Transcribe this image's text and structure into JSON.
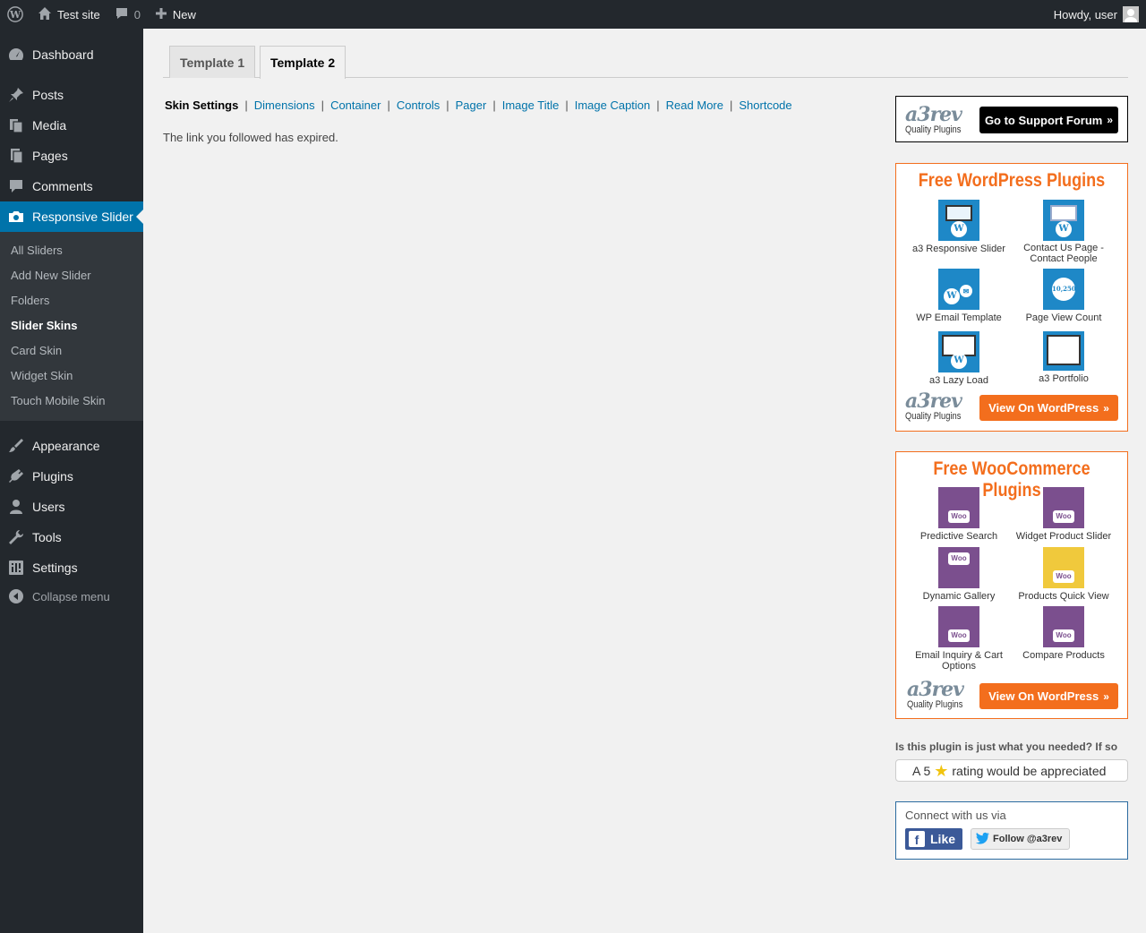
{
  "adminbar": {
    "site_name": "Test site",
    "comments_count": "0",
    "new_label": "New",
    "greeting": "Howdy, user"
  },
  "sidebar": {
    "items": [
      {
        "label": "Dashboard",
        "icon": "dashboard-icon"
      },
      {
        "label": "Posts",
        "icon": "pin-icon"
      },
      {
        "label": "Media",
        "icon": "media-icon"
      },
      {
        "label": "Pages",
        "icon": "pages-icon"
      },
      {
        "label": "Comments",
        "icon": "comment-icon"
      },
      {
        "label": "Responsive Slider",
        "icon": "camera-icon"
      },
      {
        "label": "Appearance",
        "icon": "brush-icon"
      },
      {
        "label": "Plugins",
        "icon": "plug-icon"
      },
      {
        "label": "Users",
        "icon": "user-icon"
      },
      {
        "label": "Tools",
        "icon": "wrench-icon"
      },
      {
        "label": "Settings",
        "icon": "settings-icon"
      }
    ],
    "submenu": [
      "All Sliders",
      "Add New Slider",
      "Folders",
      "Slider Skins",
      "Card Skin",
      "Widget Skin",
      "Touch Mobile Skin"
    ],
    "collapse_label": "Collapse menu"
  },
  "tabs": [
    "Template 1",
    "Template 2"
  ],
  "subnav": [
    "Skin Settings",
    "Dimensions",
    "Container",
    "Controls",
    "Pager",
    "Image Title",
    "Image Caption",
    "Read More",
    "Shortcode"
  ],
  "notice": "The link you followed has expired.",
  "support": {
    "logo_text": "a3rev",
    "logo_sub": "Quality Plugins",
    "button": "Go to Support Forum"
  },
  "wp_plugins": {
    "title": "Free WordPress Plugins",
    "items": [
      "a3 Responsive Slider",
      "Contact Us Page - Contact People",
      "WP Email Template",
      "Page View Count",
      "a3 Lazy Load",
      "a3 Portfolio"
    ],
    "button": "View On WordPress"
  },
  "woo_plugins": {
    "title": "Free WooCommerce Plugins",
    "items": [
      "Predictive Search",
      "Widget Product Slider",
      "Dynamic Gallery",
      "Products Quick View",
      "Email Inquiry & Cart Options",
      "Compare Products"
    ],
    "button": "View On WordPress",
    "thumb_label": "Woo"
  },
  "rating": {
    "question": "Is this plugin is just what you needed? If so",
    "prefix": "A 5",
    "suffix": "rating would be appreciated"
  },
  "connect": {
    "title": "Connect with us via",
    "like": "Like",
    "follow": "Follow @a3rev"
  },
  "colors": {
    "admin_bg": "#23282d",
    "accent": "#0073aa",
    "orange": "#f36e1d"
  }
}
